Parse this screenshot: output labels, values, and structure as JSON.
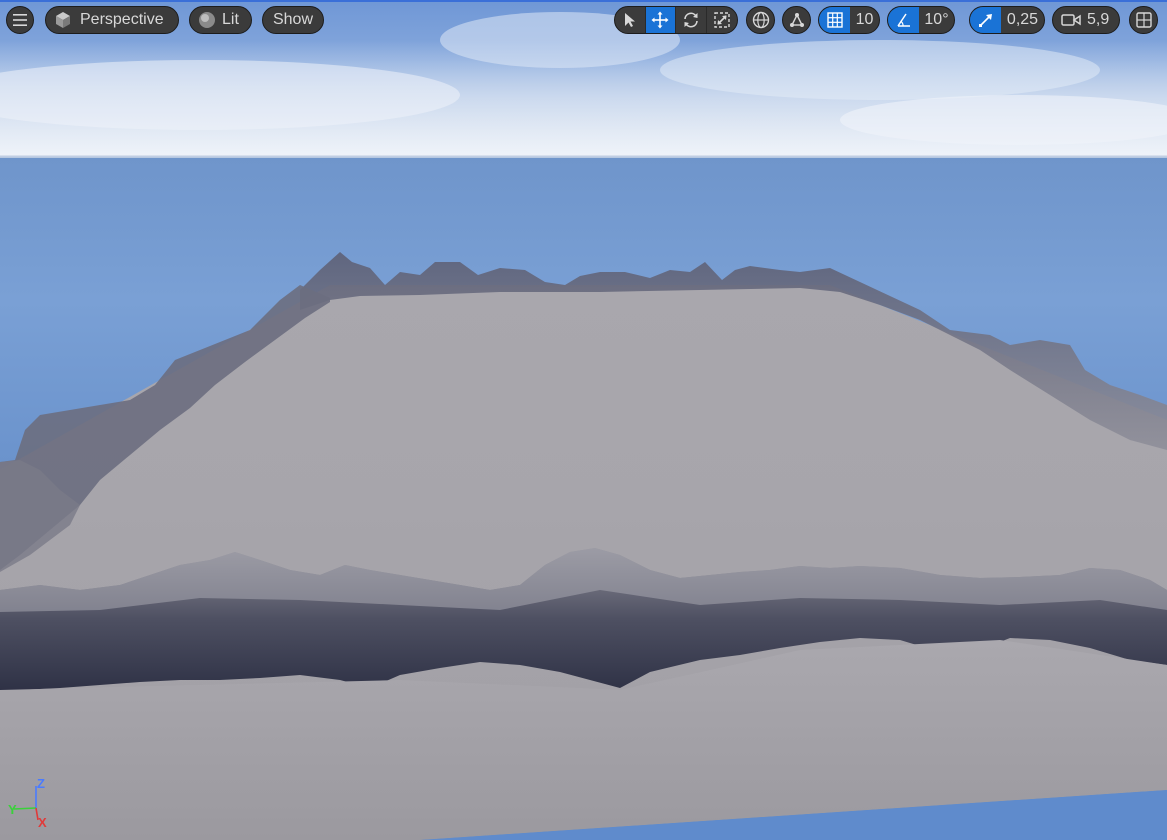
{
  "viewport": {
    "menu_icon": "hamburger-menu-icon",
    "view_mode": {
      "label": "Perspective",
      "icon": "cube-icon"
    },
    "lighting": {
      "label": "Lit",
      "icon": "sphere-icon"
    },
    "show": {
      "label": "Show"
    }
  },
  "transform_tools": [
    {
      "name": "select",
      "icon": "cursor-icon",
      "active": false
    },
    {
      "name": "translate",
      "icon": "move-arrows-icon",
      "active": true
    },
    {
      "name": "rotate",
      "icon": "rotate-icon",
      "active": false
    },
    {
      "name": "scale",
      "icon": "scale-icon",
      "active": false
    }
  ],
  "world_local_icon": "globe-icon",
  "surface_snap_icon": "surface-snap-icon",
  "grid_snap": {
    "icon": "grid-icon",
    "value": "10",
    "active": true
  },
  "rotation_snap": {
    "icon": "angle-icon",
    "value": "10°",
    "active": true
  },
  "scale_snap": {
    "icon": "scale-arrow-icon",
    "value": "0,25",
    "active": true
  },
  "camera_speed": {
    "icon": "camera-icon",
    "value": "5,9"
  },
  "layout_icon": "viewport-layout-icon",
  "axis_gizmo": {
    "z": "Z",
    "y": "Y",
    "x": "X"
  },
  "colors": {
    "accent": "#1a73d6",
    "toolbar_bg": "#3b3b3b",
    "toolbar_text": "#d8d8d8",
    "axis_x": "#e03a3a",
    "axis_y": "#3ad13a",
    "axis_z": "#4a7bff"
  }
}
